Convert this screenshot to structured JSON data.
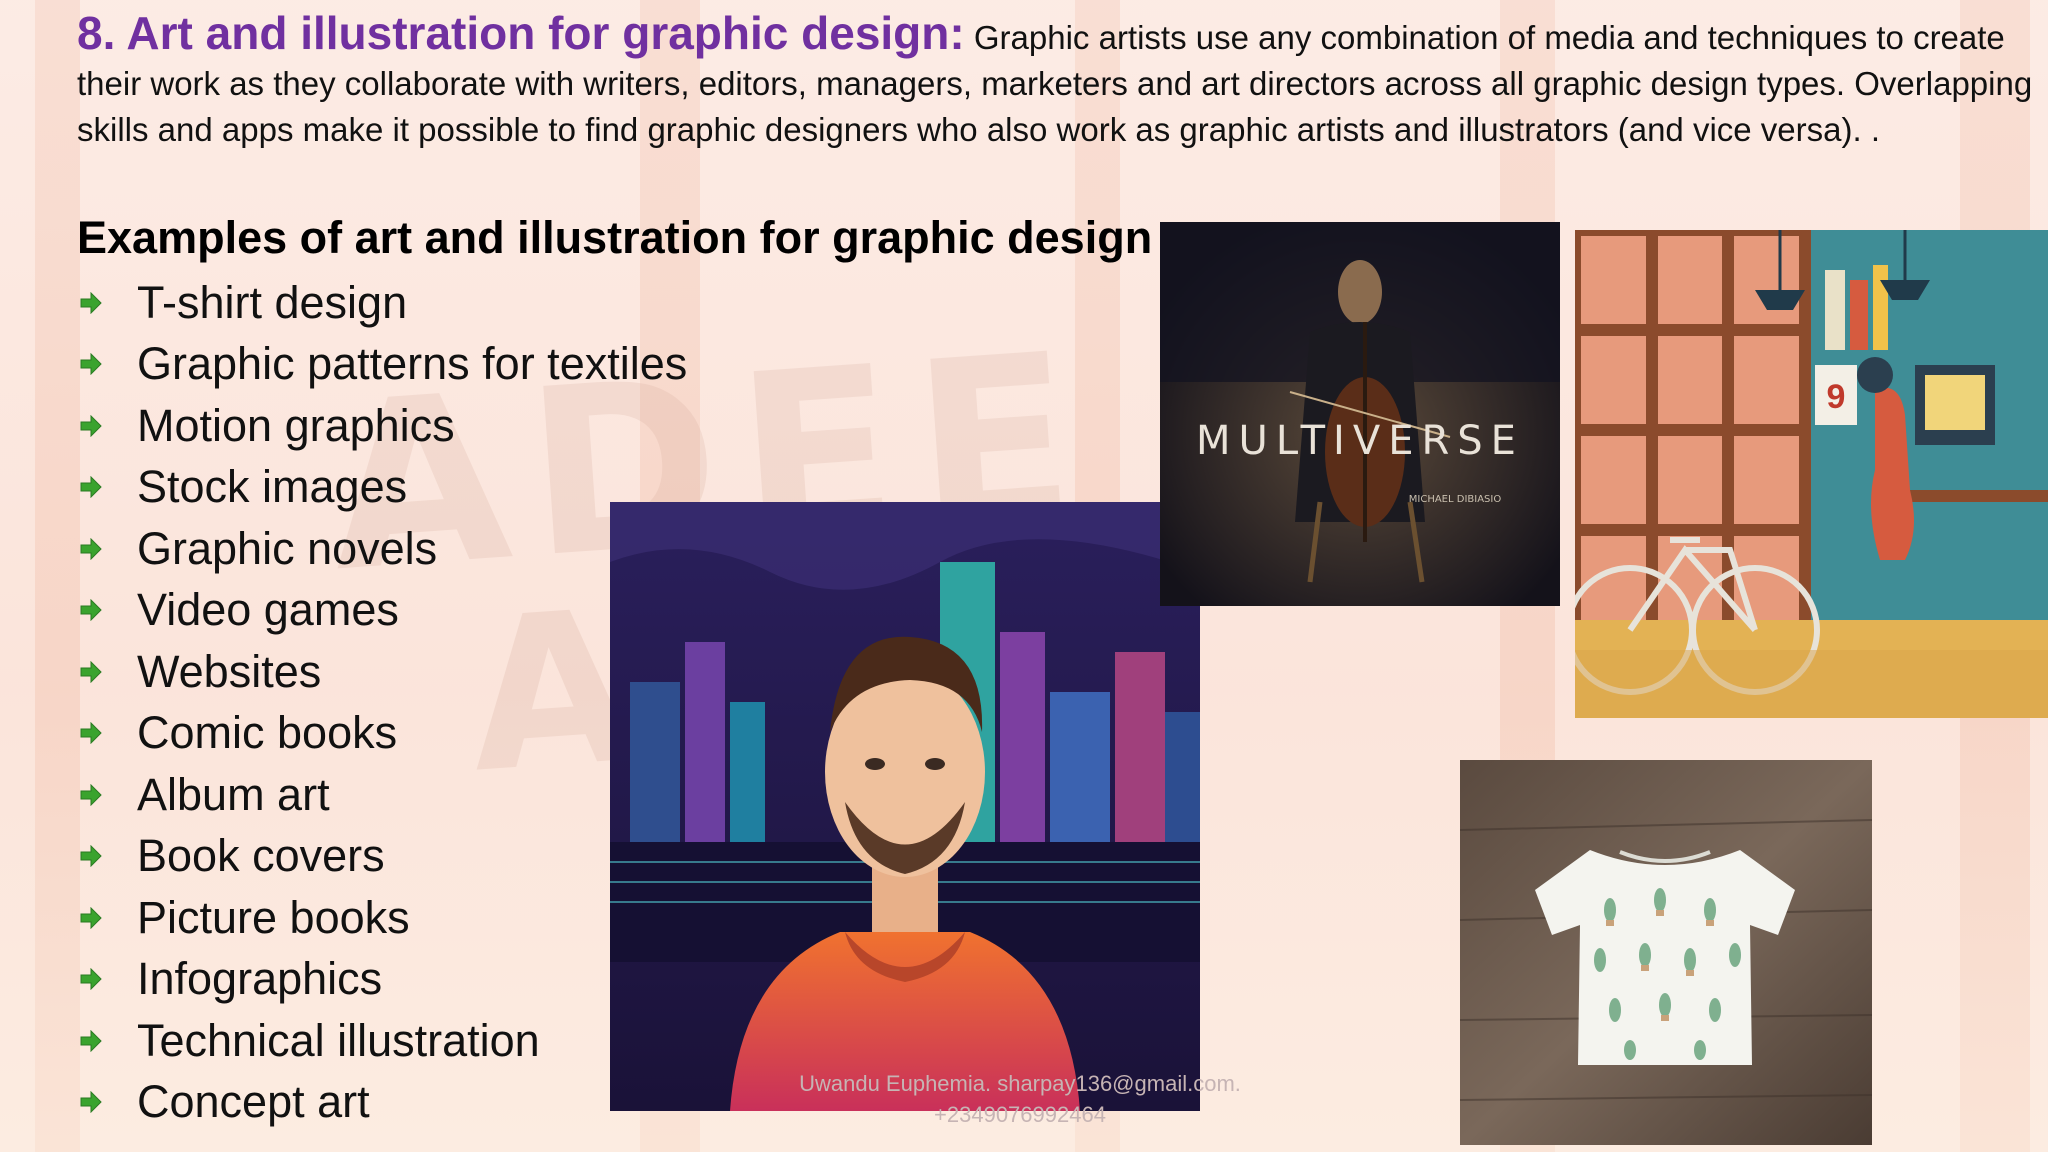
{
  "heading": "8. Art and illustration for graphic design:",
  "intro": "Graphic artists use any combination of media and techniques to create their work as they collaborate with writers, editors, managers, marketers and art directors across all graphic design types. Overlapping skills and apps make it possible to find graphic designers who also work as graphic artists and illustrators (and vice versa). .",
  "subheading": "Examples of art and illustration for graphic design",
  "examples": [
    "T-shirt design",
    "Graphic patterns for textiles",
    "Motion graphics",
    "Stock images",
    "Graphic novels",
    "Video games",
    "Websites",
    "Comic books",
    "Album art",
    "Book covers",
    "Picture books",
    "Infographics",
    "Technical illustration",
    "Concept art"
  ],
  "images": {
    "cello_title": "MULTIVERSE",
    "cello_artist": "MICHAEL DIBIASIO",
    "calendar_number": "9"
  },
  "footer": {
    "line1": "Uwandu  Euphemia.  sharpay136@gmail.com.",
    "line2": "+2349076992464"
  },
  "colors": {
    "heading": "#7030a0",
    "bullet": "#3aa32e",
    "background": "#fbe9e1"
  },
  "icons": {
    "bullet": "green-arrow-icon"
  }
}
